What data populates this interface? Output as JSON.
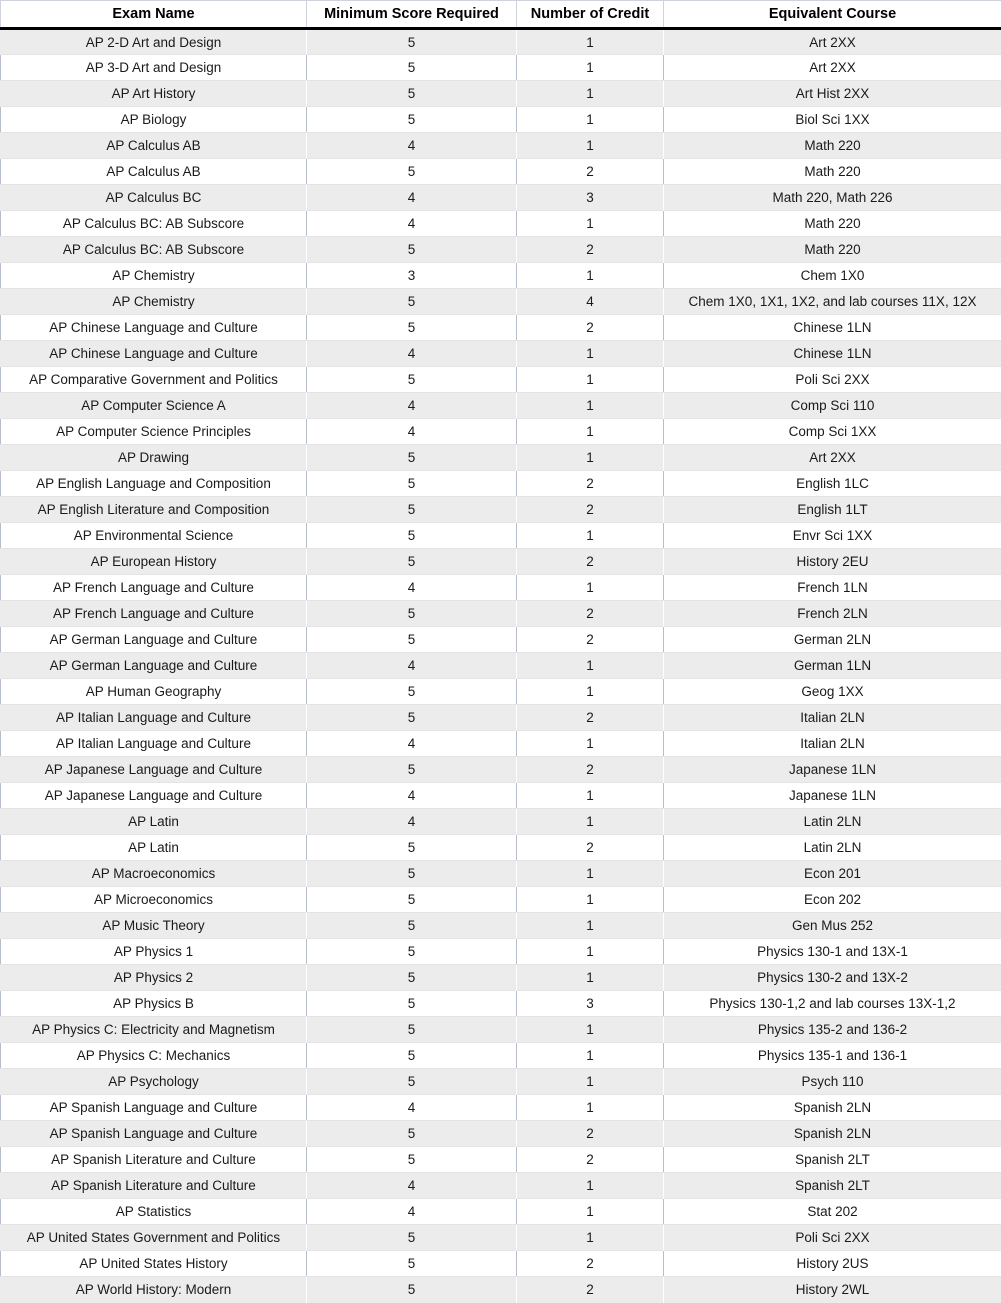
{
  "table": {
    "columns": [
      "Exam Name",
      "Minimum Score Required",
      "Number of Credit",
      "Equivalent Course"
    ],
    "rows": [
      [
        "AP 2-D Art and Design",
        "5",
        "1",
        "Art 2XX"
      ],
      [
        "AP 3-D Art and Design",
        "5",
        "1",
        "Art 2XX"
      ],
      [
        "AP Art History",
        "5",
        "1",
        "Art Hist 2XX"
      ],
      [
        "AP Biology",
        "5",
        "1",
        "Biol Sci 1XX"
      ],
      [
        "AP Calculus AB",
        "4",
        "1",
        "Math 220"
      ],
      [
        "AP Calculus AB",
        "5",
        "2",
        "Math 220"
      ],
      [
        "AP Calculus BC",
        "4",
        "3",
        "Math 220, Math 226"
      ],
      [
        "AP Calculus BC: AB Subscore",
        "4",
        "1",
        "Math 220"
      ],
      [
        "AP Calculus BC: AB Subscore",
        "5",
        "2",
        "Math 220"
      ],
      [
        "AP Chemistry",
        "3",
        "1",
        "Chem 1X0"
      ],
      [
        "AP Chemistry",
        "5",
        "4",
        "Chem 1X0, 1X1, 1X2, and lab courses 11X, 12X"
      ],
      [
        "AP Chinese Language and Culture",
        "5",
        "2",
        "Chinese 1LN"
      ],
      [
        "AP Chinese Language and Culture",
        "4",
        "1",
        "Chinese 1LN"
      ],
      [
        "AP Comparative Government and Politics",
        "5",
        "1",
        "Poli Sci 2XX"
      ],
      [
        "AP Computer Science A",
        "4",
        "1",
        "Comp Sci 110"
      ],
      [
        "AP Computer Science Principles",
        "4",
        "1",
        "Comp Sci 1XX"
      ],
      [
        "AP Drawing",
        "5",
        "1",
        "Art 2XX"
      ],
      [
        "AP English Language and Composition",
        "5",
        "2",
        "English 1LC"
      ],
      [
        "AP English Literature and Composition",
        "5",
        "2",
        "English 1LT"
      ],
      [
        "AP Environmental Science",
        "5",
        "1",
        "Envr Sci 1XX"
      ],
      [
        "AP European History",
        "5",
        "2",
        "History 2EU"
      ],
      [
        "AP French Language and Culture",
        "4",
        "1",
        "French 1LN"
      ],
      [
        "AP French Language and Culture",
        "5",
        "2",
        "French 2LN"
      ],
      [
        "AP German Language and Culture",
        "5",
        "2",
        "German 2LN"
      ],
      [
        "AP German Language and Culture",
        "4",
        "1",
        "German 1LN"
      ],
      [
        "AP Human Geography",
        "5",
        "1",
        "Geog 1XX"
      ],
      [
        "AP Italian Language and Culture",
        "5",
        "2",
        "Italian 2LN"
      ],
      [
        "AP Italian Language and Culture",
        "4",
        "1",
        "Italian 2LN"
      ],
      [
        "AP Japanese Language and Culture",
        "5",
        "2",
        "Japanese 1LN"
      ],
      [
        "AP Japanese Language and Culture",
        "4",
        "1",
        "Japanese 1LN"
      ],
      [
        "AP Latin",
        "4",
        "1",
        "Latin 2LN"
      ],
      [
        "AP Latin",
        "5",
        "2",
        "Latin 2LN"
      ],
      [
        "AP Macroeconomics",
        "5",
        "1",
        "Econ 201"
      ],
      [
        "AP Microeconomics",
        "5",
        "1",
        "Econ 202"
      ],
      [
        "AP Music Theory",
        "5",
        "1",
        "Gen Mus 252"
      ],
      [
        "AP Physics 1",
        "5",
        "1",
        "Physics 130-1 and 13X-1"
      ],
      [
        "AP Physics 2",
        "5",
        "1",
        "Physics 130-2 and 13X-2"
      ],
      [
        "AP Physics B",
        "5",
        "3",
        "Physics 130-1,2 and lab courses 13X-1,2"
      ],
      [
        "AP Physics C: Electricity and Magnetism",
        "5",
        "1",
        "Physics 135-2 and 136-2"
      ],
      [
        "AP Physics C: Mechanics",
        "5",
        "1",
        "Physics 135-1 and 136-1"
      ],
      [
        "AP Psychology",
        "5",
        "1",
        "Psych 110"
      ],
      [
        "AP Spanish Language and Culture",
        "4",
        "1",
        "Spanish 2LN"
      ],
      [
        "AP Spanish Language and Culture",
        "5",
        "2",
        "Spanish 2LN"
      ],
      [
        "AP Spanish Literature and Culture",
        "5",
        "2",
        "Spanish 2LT"
      ],
      [
        "AP Spanish Literature and Culture",
        "4",
        "1",
        "Spanish 2LT"
      ],
      [
        "AP Statistics",
        "4",
        "1",
        "Stat 202"
      ],
      [
        "AP United States Government and Politics",
        "5",
        "1",
        "Poli Sci 2XX"
      ],
      [
        "AP United States History",
        "5",
        "2",
        "History 2US"
      ],
      [
        "AP World History: Modern",
        "5",
        "2",
        "History 2WL"
      ]
    ]
  },
  "colors": {
    "header_rule": "#000000",
    "row_stripe": "#ececec",
    "row_base": "#ffffff",
    "grid_line": "#b6bdcd",
    "text": "#1a1a1a"
  }
}
